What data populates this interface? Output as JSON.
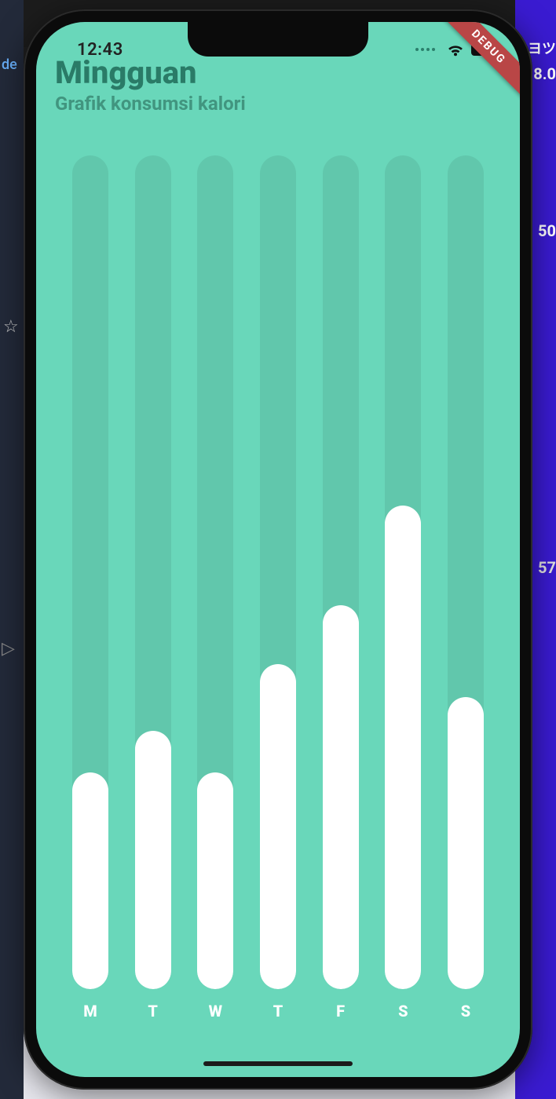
{
  "backdrop": {
    "link_text": "de",
    "right_top_glyph": "ヨツ",
    "right_num_a": "8.0",
    "right_num_b": "50",
    "right_num_c": "57"
  },
  "status": {
    "time": "12:43"
  },
  "debug_ribbon": "DEBUG",
  "titles": {
    "title": "Mingguan",
    "subtitle": "Grafik konsumsi kalori"
  },
  "chart_data": {
    "type": "bar",
    "title": "Mingguan — Grafik konsumsi kalori",
    "xlabel": "",
    "ylabel": "",
    "ylim": [
      0,
      100
    ],
    "categories": [
      "M",
      "T",
      "W",
      "T",
      "F",
      "S",
      "S"
    ],
    "values": [
      26,
      31,
      26,
      39,
      46,
      58,
      35
    ]
  }
}
